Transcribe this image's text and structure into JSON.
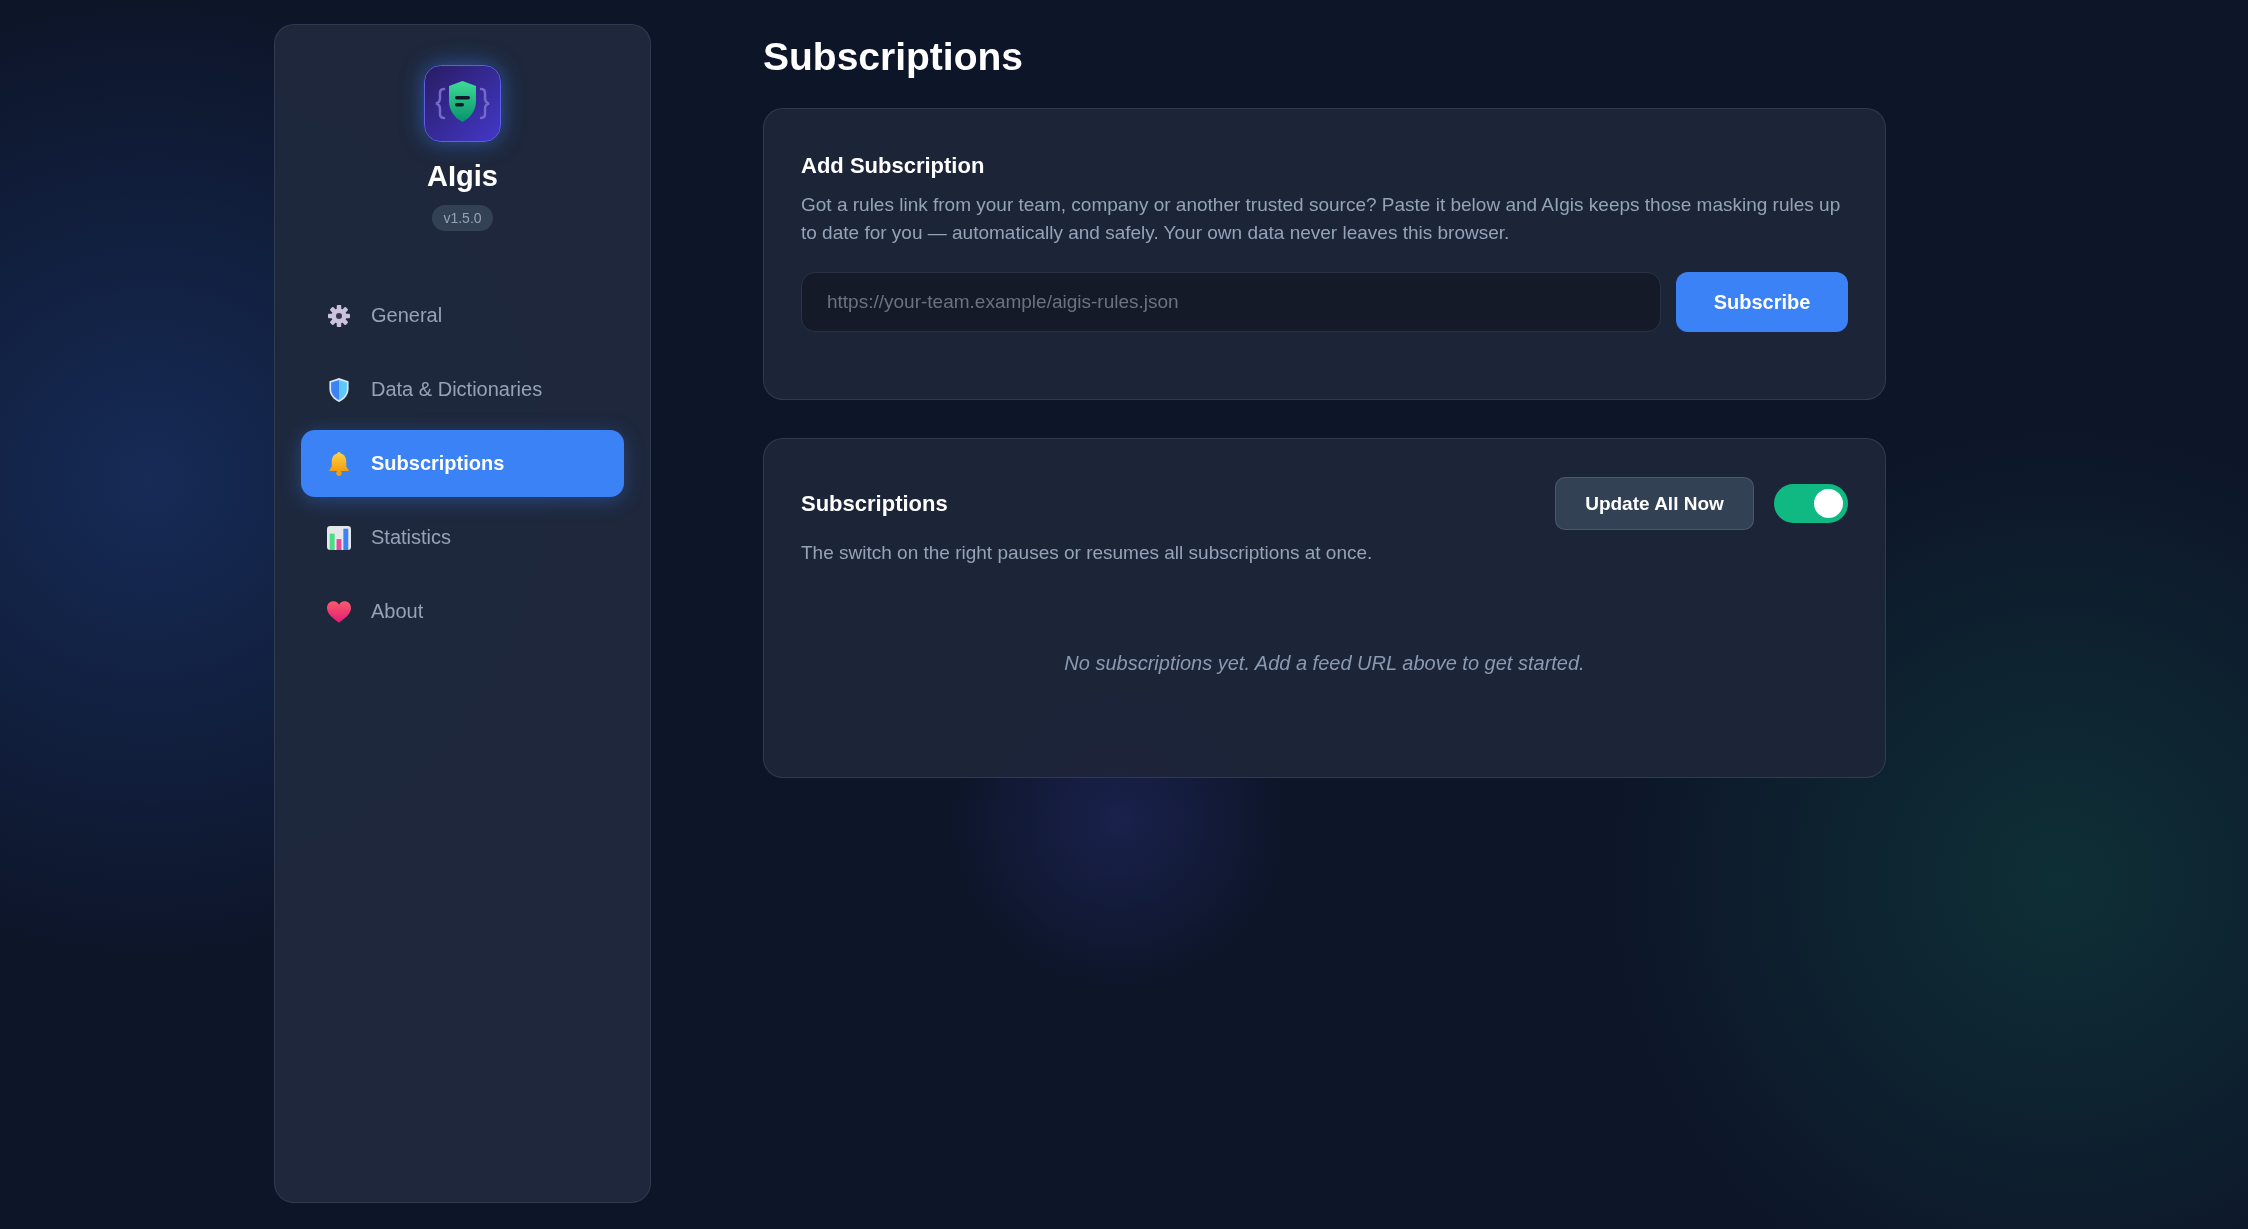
{
  "sidebar": {
    "app_name": "AIgis",
    "version": "v1.5.0",
    "items": [
      {
        "label": "General",
        "selected": false
      },
      {
        "label": "Data & Dictionaries",
        "selected": false
      },
      {
        "label": "Subscriptions",
        "selected": true
      },
      {
        "label": "Statistics",
        "selected": false
      },
      {
        "label": "About",
        "selected": false
      }
    ]
  },
  "page_title": "Subscriptions",
  "add_card": {
    "title": "Add Subscription",
    "description": "Got a rules link from your team, company or another trusted source? Paste it below and AIgis keeps those masking rules up to date for you — automatically and safely. Your own data never leaves this browser.",
    "url_field": {
      "placeholder": "https://your-team.example/aigis-rules.json"
    },
    "button": "Subscribe"
  },
  "list_card": {
    "title": "Subscriptions",
    "update_button": "Update All Now",
    "toggle": {
      "on": true
    },
    "description": "The switch on the right pauses or resumes all subscriptions at once.",
    "empty_message": "No subscriptions yet. Add a feed URL above to get started."
  }
}
